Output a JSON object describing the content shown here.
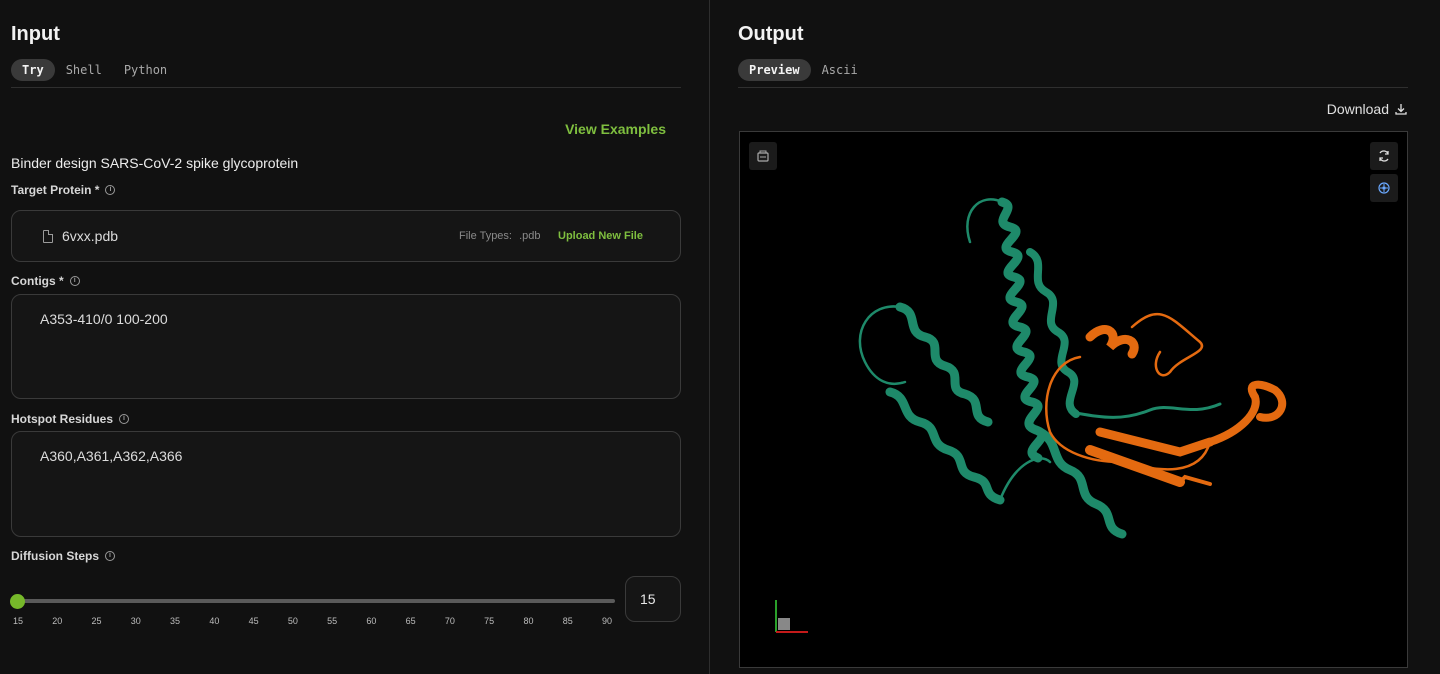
{
  "input": {
    "title": "Input",
    "tabs": [
      {
        "label": "Try",
        "active": true
      },
      {
        "label": "Shell",
        "active": false
      },
      {
        "label": "Python",
        "active": false
      }
    ],
    "view_examples": "View Examples",
    "example_title": "Binder design SARS-CoV-2 spike glycoprotein",
    "target_protein": {
      "label": "Target Protein *",
      "file_name": "6vxx.pdb",
      "file_types_label": "File Types:",
      "file_types_value": ".pdb",
      "upload_label": "Upload New File"
    },
    "contigs": {
      "label": "Contigs *",
      "value": "A353-410/0 100-200"
    },
    "hotspot_residues": {
      "label": "Hotspot Residues",
      "value": "A360,A361,A362,A366"
    },
    "diffusion_steps": {
      "label": "Diffusion Steps",
      "value": "15",
      "ticks": [
        "15",
        "20",
        "25",
        "30",
        "35",
        "40",
        "45",
        "50",
        "55",
        "60",
        "65",
        "70",
        "75",
        "80",
        "85",
        "90"
      ]
    }
  },
  "output": {
    "title": "Output",
    "tabs": [
      {
        "label": "Preview",
        "active": true
      },
      {
        "label": "Ascii",
        "active": false
      }
    ],
    "download_label": "Download"
  },
  "colors": {
    "accent": "#76b82a",
    "chain_a": "#1e8a6a",
    "chain_b": "#e46a10"
  }
}
